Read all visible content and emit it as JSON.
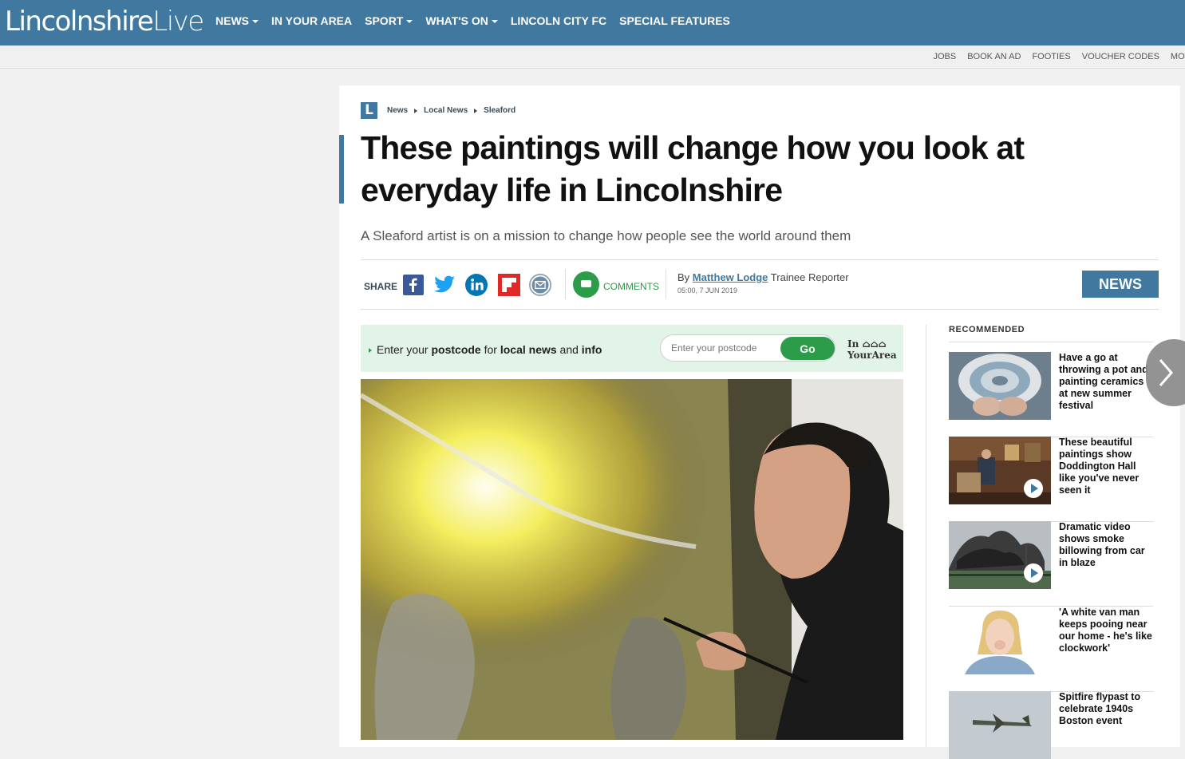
{
  "brand": {
    "name_a": "Lincolnshire",
    "name_b": "Live",
    "color": "#40789f"
  },
  "nav": {
    "items": [
      {
        "label": "NEWS",
        "dropdown": true
      },
      {
        "label": "IN YOUR AREA",
        "dropdown": false
      },
      {
        "label": "SPORT",
        "dropdown": true
      },
      {
        "label": "WHAT'S ON",
        "dropdown": true
      },
      {
        "label": "LINCOLN CITY FC",
        "dropdown": false
      },
      {
        "label": "SPECIAL FEATURES",
        "dropdown": false
      }
    ]
  },
  "subnav": {
    "items": [
      "JOBS",
      "BOOK AN AD",
      "FOOTIES",
      "VOUCHER CODES",
      "MOTORS"
    ]
  },
  "breadcrumb": {
    "logo": "L",
    "items": [
      "News",
      "Local News",
      "Sleaford"
    ]
  },
  "article": {
    "headline": "These paintings will change how you look at everyday life in Lincolnshire",
    "standfirst": "A Sleaford artist is on a mission to change how people see the world around them",
    "share_label": "SHARE",
    "comments_label": "COMMENTS",
    "by": "By",
    "author": "Matthew Lodge",
    "role": "Trainee Reporter",
    "date": "05:00, 7 JUN 2019",
    "tag": "NEWS"
  },
  "share_icons": [
    "facebook-icon",
    "twitter-icon",
    "linkedin-icon",
    "flipboard-icon",
    "email-icon"
  ],
  "in_your_area": {
    "t1": "Enter your ",
    "t2": "postcode",
    "t3": " for ",
    "t4": "local news",
    "t5": " and ",
    "t6": "info",
    "placeholder": "Enter your postcode",
    "button": "Go",
    "logo_line1": "In",
    "logo_line2": "YourArea"
  },
  "recommended": {
    "heading": "RECOMMENDED",
    "items": [
      {
        "title": "Have a go at throwing a pot and painting ceramics at new summer festival",
        "video": false
      },
      {
        "title": "These beautiful paintings show Doddington Hall like you've never seen it",
        "video": true
      },
      {
        "title": "Dramatic video shows smoke billowing from car in blaze",
        "video": true
      },
      {
        "title": "'A white van man keeps pooing near our home - he's like clockwork'",
        "video": false
      },
      {
        "title": "Spitfire flypast to celebrate 1940s Boston event",
        "video": false
      }
    ]
  },
  "colors": {
    "primary": "#40789f",
    "green": "#2c9c4a",
    "iya_bg": "#e2f3e8"
  }
}
